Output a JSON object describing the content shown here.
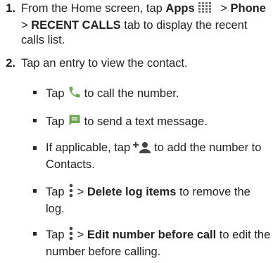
{
  "steps": [
    {
      "number": "1.",
      "parts": {
        "t1": "From the Home screen, tap ",
        "b1": "Apps",
        "t2": " > ",
        "b2": "Phone",
        "t3": " > ",
        "b3": "RECENT CALLS",
        "t4": " tab to display the recent calls list."
      }
    },
    {
      "number": "2.",
      "text": "Tap an entry to view the contact."
    }
  ],
  "bullets": [
    {
      "pre": "Tap",
      "icon": "phone-icon",
      "post": "to call the number."
    },
    {
      "pre": "Tap",
      "icon": "message-icon",
      "post": "to send a text message."
    },
    {
      "pre": "If applicable, tap",
      "icon": "add-contact-icon",
      "post": "to add the number to Contacts."
    },
    {
      "pre": "Tap",
      "icon": "more-options-icon",
      "mid": "> ",
      "bold": "Delete log items",
      "post": " to remove the log."
    },
    {
      "pre": "Tap",
      "icon": "more-options-icon",
      "mid": "> ",
      "bold": "Edit number before call",
      "post": " to edit the number before calling."
    }
  ],
  "colors": {
    "icon_green": "#6aa84f",
    "text": "#222222"
  }
}
